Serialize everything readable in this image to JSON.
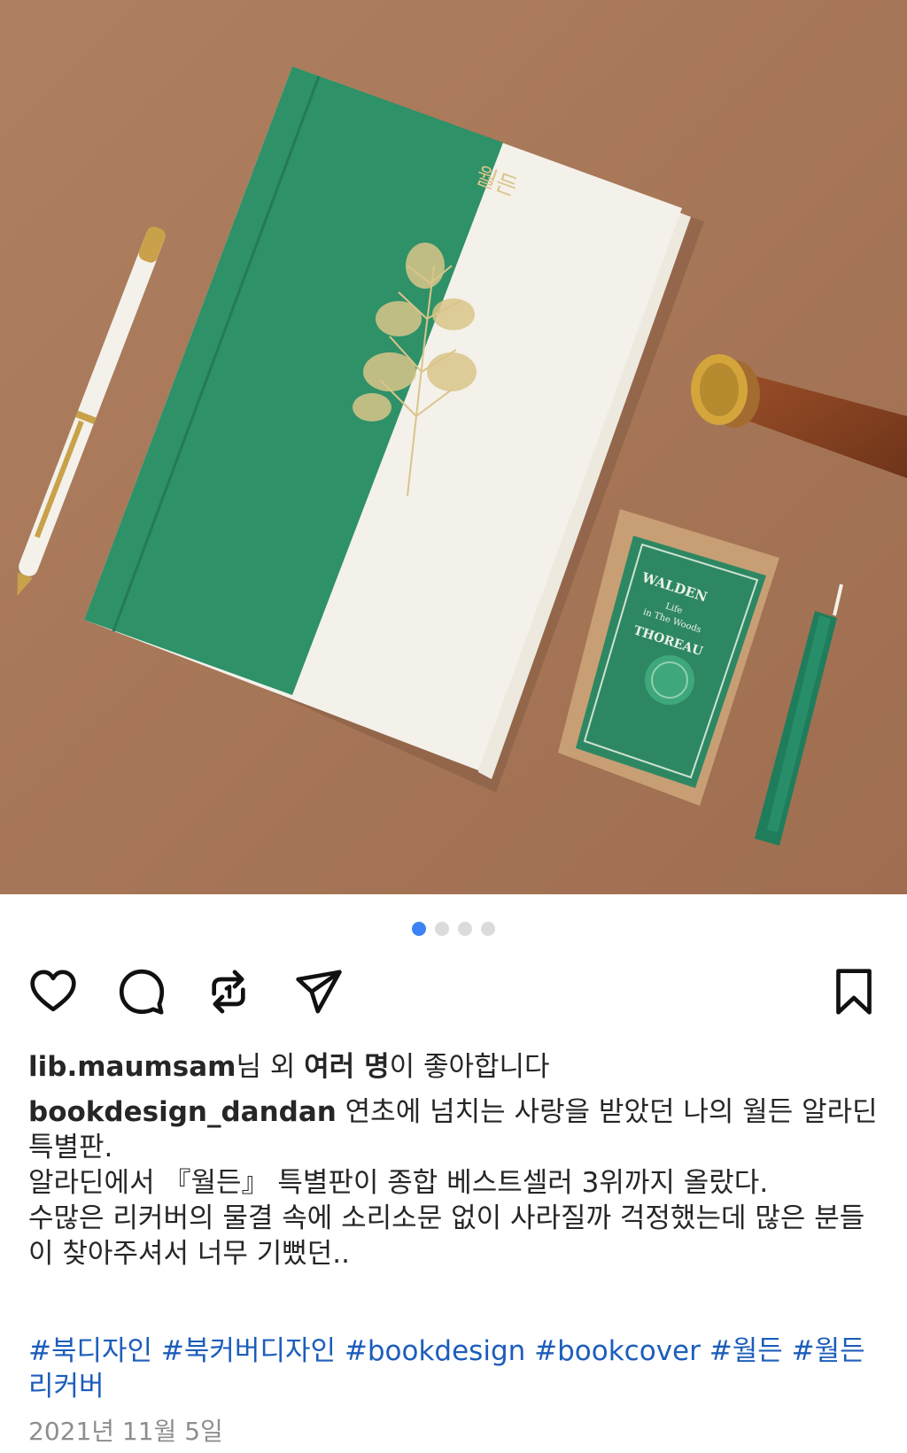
{
  "carousel": {
    "count": 4,
    "active_index": 0
  },
  "actions": {
    "like_icon": "heart-icon",
    "comment_icon": "comment-icon",
    "repost_icon": "repost-icon",
    "share_icon": "send-icon",
    "save_icon": "bookmark-icon"
  },
  "photo": {
    "book_title": "월든",
    "box_title": "WALDEN",
    "box_subtitle_1": "Life",
    "box_subtitle_2": "in The Woods",
    "box_author": "THOREAU"
  },
  "likes": {
    "username": "lib.maumsam",
    "middle": "님 외 ",
    "others": "여러 명",
    "suffix": "이 좋아합니다"
  },
  "caption": {
    "username": "bookdesign_dandan",
    "line1": " 연초에 넘치는 사랑을 받았던 나의 월든 알라딘 특별판.",
    "line2": "알라딘에서 『월든』 특별판이 종합 베스트셀러 3위까지 올랐다.",
    "line3": "수많은 리커버의 물결 속에 소리소문 없이 사라질까 걱정했는데 많은 분들이 찾아주셔서 너무 기뻤던.."
  },
  "hashtags": [
    "#북디자인",
    "#북커버디자인",
    "#bookdesign",
    "#bookcover",
    "#월든",
    "#월든리커버"
  ],
  "date": "2021년 11월 5일",
  "colors": {
    "background_photo": "#a9795a",
    "book_green": "#2e9168",
    "hashtag": "#1c5dbb",
    "active_dot": "#3b82f6"
  }
}
